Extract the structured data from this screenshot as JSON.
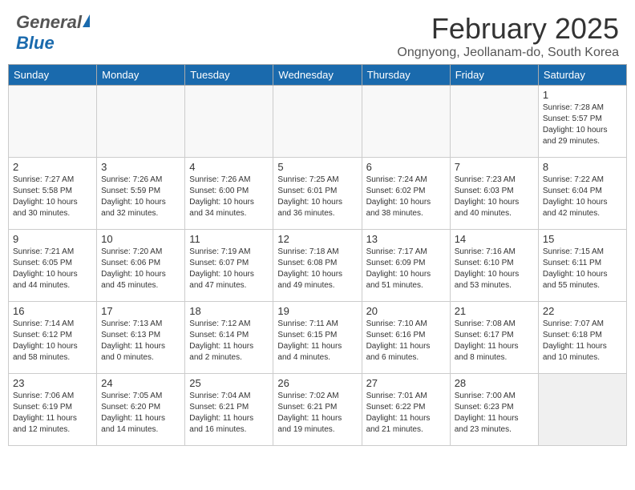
{
  "header": {
    "logo_general": "General",
    "logo_blue": "Blue",
    "month_title": "February 2025",
    "location": "Ongnyong, Jeollanam-do, South Korea"
  },
  "days_of_week": [
    "Sunday",
    "Monday",
    "Tuesday",
    "Wednesday",
    "Thursday",
    "Friday",
    "Saturday"
  ],
  "weeks": [
    [
      {
        "day": "",
        "info": ""
      },
      {
        "day": "",
        "info": ""
      },
      {
        "day": "",
        "info": ""
      },
      {
        "day": "",
        "info": ""
      },
      {
        "day": "",
        "info": ""
      },
      {
        "day": "",
        "info": ""
      },
      {
        "day": "1",
        "info": "Sunrise: 7:28 AM\nSunset: 5:57 PM\nDaylight: 10 hours\nand 29 minutes."
      }
    ],
    [
      {
        "day": "2",
        "info": "Sunrise: 7:27 AM\nSunset: 5:58 PM\nDaylight: 10 hours\nand 30 minutes."
      },
      {
        "day": "3",
        "info": "Sunrise: 7:26 AM\nSunset: 5:59 PM\nDaylight: 10 hours\nand 32 minutes."
      },
      {
        "day": "4",
        "info": "Sunrise: 7:26 AM\nSunset: 6:00 PM\nDaylight: 10 hours\nand 34 minutes."
      },
      {
        "day": "5",
        "info": "Sunrise: 7:25 AM\nSunset: 6:01 PM\nDaylight: 10 hours\nand 36 minutes."
      },
      {
        "day": "6",
        "info": "Sunrise: 7:24 AM\nSunset: 6:02 PM\nDaylight: 10 hours\nand 38 minutes."
      },
      {
        "day": "7",
        "info": "Sunrise: 7:23 AM\nSunset: 6:03 PM\nDaylight: 10 hours\nand 40 minutes."
      },
      {
        "day": "8",
        "info": "Sunrise: 7:22 AM\nSunset: 6:04 PM\nDaylight: 10 hours\nand 42 minutes."
      }
    ],
    [
      {
        "day": "9",
        "info": "Sunrise: 7:21 AM\nSunset: 6:05 PM\nDaylight: 10 hours\nand 44 minutes."
      },
      {
        "day": "10",
        "info": "Sunrise: 7:20 AM\nSunset: 6:06 PM\nDaylight: 10 hours\nand 45 minutes."
      },
      {
        "day": "11",
        "info": "Sunrise: 7:19 AM\nSunset: 6:07 PM\nDaylight: 10 hours\nand 47 minutes."
      },
      {
        "day": "12",
        "info": "Sunrise: 7:18 AM\nSunset: 6:08 PM\nDaylight: 10 hours\nand 49 minutes."
      },
      {
        "day": "13",
        "info": "Sunrise: 7:17 AM\nSunset: 6:09 PM\nDaylight: 10 hours\nand 51 minutes."
      },
      {
        "day": "14",
        "info": "Sunrise: 7:16 AM\nSunset: 6:10 PM\nDaylight: 10 hours\nand 53 minutes."
      },
      {
        "day": "15",
        "info": "Sunrise: 7:15 AM\nSunset: 6:11 PM\nDaylight: 10 hours\nand 55 minutes."
      }
    ],
    [
      {
        "day": "16",
        "info": "Sunrise: 7:14 AM\nSunset: 6:12 PM\nDaylight: 10 hours\nand 58 minutes."
      },
      {
        "day": "17",
        "info": "Sunrise: 7:13 AM\nSunset: 6:13 PM\nDaylight: 11 hours\nand 0 minutes."
      },
      {
        "day": "18",
        "info": "Sunrise: 7:12 AM\nSunset: 6:14 PM\nDaylight: 11 hours\nand 2 minutes."
      },
      {
        "day": "19",
        "info": "Sunrise: 7:11 AM\nSunset: 6:15 PM\nDaylight: 11 hours\nand 4 minutes."
      },
      {
        "day": "20",
        "info": "Sunrise: 7:10 AM\nSunset: 6:16 PM\nDaylight: 11 hours\nand 6 minutes."
      },
      {
        "day": "21",
        "info": "Sunrise: 7:08 AM\nSunset: 6:17 PM\nDaylight: 11 hours\nand 8 minutes."
      },
      {
        "day": "22",
        "info": "Sunrise: 7:07 AM\nSunset: 6:18 PM\nDaylight: 11 hours\nand 10 minutes."
      }
    ],
    [
      {
        "day": "23",
        "info": "Sunrise: 7:06 AM\nSunset: 6:19 PM\nDaylight: 11 hours\nand 12 minutes."
      },
      {
        "day": "24",
        "info": "Sunrise: 7:05 AM\nSunset: 6:20 PM\nDaylight: 11 hours\nand 14 minutes."
      },
      {
        "day": "25",
        "info": "Sunrise: 7:04 AM\nSunset: 6:21 PM\nDaylight: 11 hours\nand 16 minutes."
      },
      {
        "day": "26",
        "info": "Sunrise: 7:02 AM\nSunset: 6:21 PM\nDaylight: 11 hours\nand 19 minutes."
      },
      {
        "day": "27",
        "info": "Sunrise: 7:01 AM\nSunset: 6:22 PM\nDaylight: 11 hours\nand 21 minutes."
      },
      {
        "day": "28",
        "info": "Sunrise: 7:00 AM\nSunset: 6:23 PM\nDaylight: 11 hours\nand 23 minutes."
      },
      {
        "day": "",
        "info": ""
      }
    ]
  ]
}
